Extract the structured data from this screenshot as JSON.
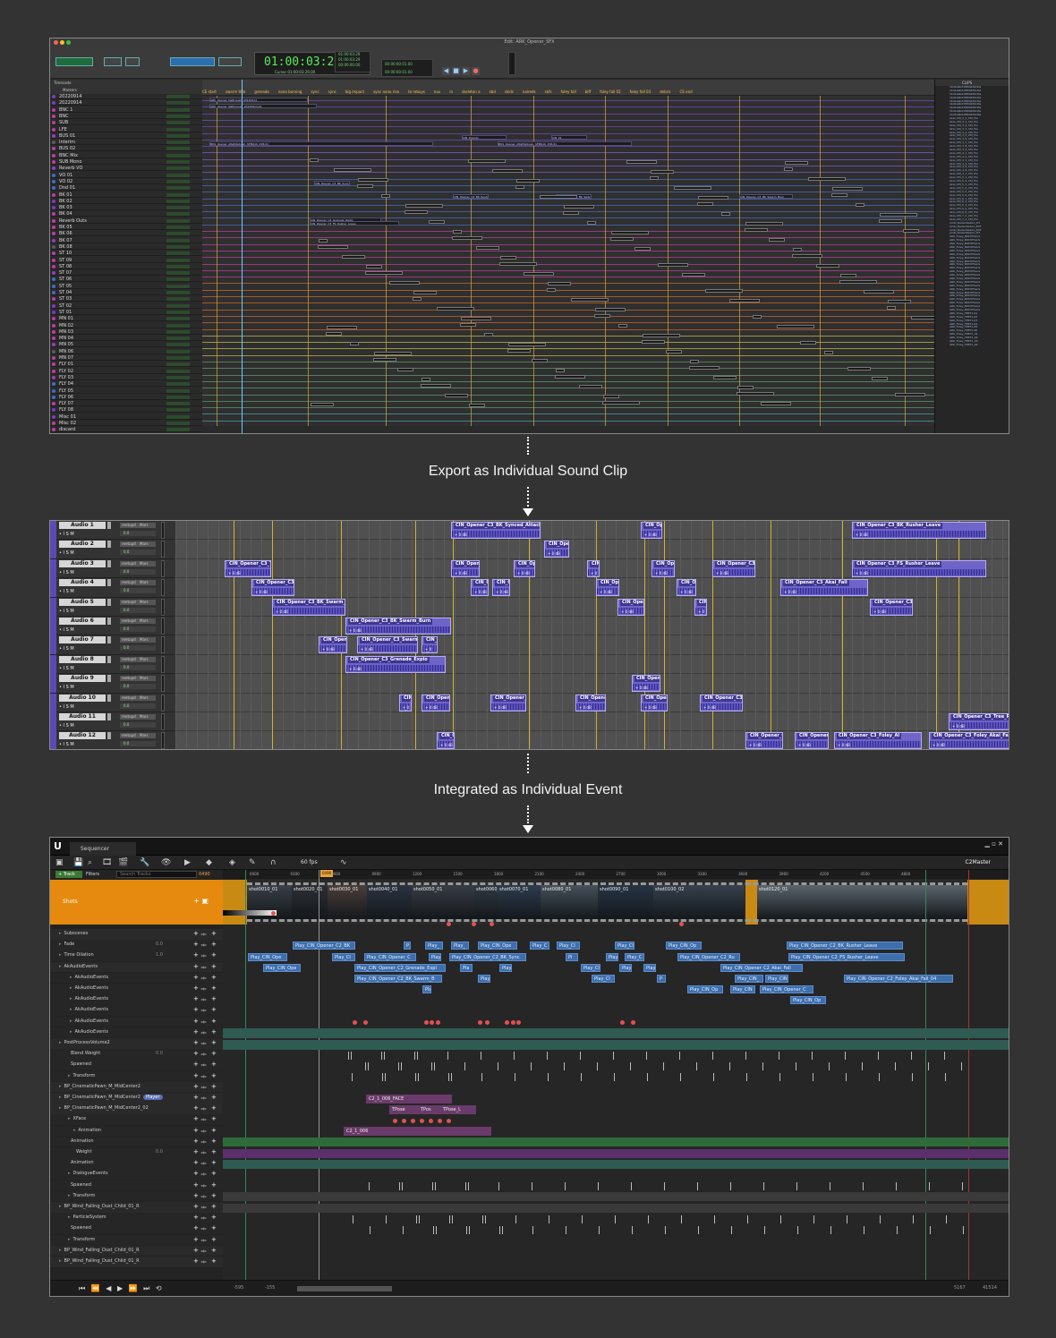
{
  "captions": {
    "export": "Export as Individual Sound Clip",
    "integrate": "Integrated as Individual Event"
  },
  "protools": {
    "window_title": "Edit: ARK_Opener_SFX",
    "main_counter": "01:00:03:29",
    "counter_sub": "Cursor  01:00:03:29.00",
    "selection_start": "01:00:03:29",
    "selection_end": "01:00:03:29",
    "selection_length": "00:00:00:00",
    "grid_value": "00:00:00:01.00",
    "nudge_value": "00:00:00:01.00",
    "timecode_label": "Timecode",
    "markers_label": "Markers",
    "markers": [
      "CE start",
      "swarm title",
      "grenade",
      "nano burning",
      "sync",
      "sync",
      "big impact",
      "sync nano rise",
      "to rebuys",
      "nuv",
      "in",
      "skeleton a",
      "sbd",
      "skids",
      "nalreds",
      "skfs",
      "foley fall",
      "biff",
      "foley fall 02",
      "foley fall 03",
      "debris",
      "CE end"
    ],
    "clips_header": "CLIPS",
    "tracks": [
      "20220914",
      "20220914",
      "BNC 1",
      "BNC",
      "SUB",
      "LFE",
      "BUS 01",
      "Interim",
      "BUS 02",
      "BNC Mix",
      "SUB Mono",
      "Reverb VO",
      "VO 01",
      "VO 02",
      "Dnd 01",
      "BK 01",
      "BK 02",
      "BK 03",
      "BK 04",
      "Reverb Outs",
      "BK 05",
      "BK 06",
      "BK 07",
      "BK 08",
      "ST 10",
      "ST 09",
      "ST 08",
      "ST 07",
      "ST 06",
      "ST 05",
      "ST 04",
      "ST 03",
      "ST 02",
      "ST 01",
      "MN 01",
      "MN 02",
      "MN 03",
      "MN 04",
      "MN 05",
      "MN 06",
      "MN 07",
      "FLY 01",
      "FLY 02",
      "FLY 03",
      "FLY 04",
      "FLY 05",
      "FLY 06",
      "FLY 07",
      "FLY 08",
      "Misc 01",
      "Misc 02",
      "discard"
    ],
    "clips": [
      "ARK_Opener_Deftrough_20220914",
      "ARK_Opener_Nathrough_20220914-01",
      "BUS_Opener_AltaMixdown_SFM010_158-01",
      "BUS_Opener_AltaMixdown_SFM010_158-01",
      "CIN_Opener",
      "CIN_01",
      "CIN_Opener_C3_BK_Synced_Attack",
      "CIN_Opener_C3_BK_Rusher_Lopes",
      "CIN_Opener_C3_BK_Swarm_Inflo",
      "CIN_Opener_C3_BK_Swarm_Burn",
      "CIN_Opener_C3_Grenade_Radio",
      "CIN_Opener_C3_FS_Rusher_Lopes",
      "ATMOS 2.1_01-01",
      "ATMOS 2.1_02"
    ],
    "cliplist": [
      "1bd1a9bd1f809b54dda",
      "1bd1a9bd1f809b54dda",
      "1bd1a9bd1f809b54dda",
      "1bd1a9bd1f809b54dda",
      "1bd1a9bd1f809b54dda",
      "1bd1a9bd1f809b54dda",
      "1bd1a9bd1f809b54dda",
      "1bd1a9bd1f809b54dda",
      "1bd1a9bd1f809b54dda",
      "Akai_CM_3_1_CM_Tra",
      "Akai_CM_3_1_CM_Tra",
      "Akai_CM_3_2_CM_Tra",
      "Akai_CM_3_3_CM_Tra",
      "Akai_CM_3_4_CM_Tra",
      "Akai_CM_3_5_CM_Tra",
      "Akai_CM_3_6_CM_Tra",
      "Akai_CM_3_7_CM_Tra",
      "Akai_CM_3_8_CM_Tra",
      "Akai_CM_3_9_CM_Tra",
      "Akai_CM_4_1_CM_Tra",
      "Akai_CM_4_2_CM_Tra",
      "Akai_CM_4_3_CM_Tra",
      "Akai_CM_4_4_CM_Tra",
      "Akai_CM_4_5_CM_Tra",
      "Akai_CM_4_6_CM_Tra",
      "Akai_CM_4_7_CM_Tra",
      "Akai_CM_5_1_CM_Tra",
      "Akai_CM_5_2_CM_Tra",
      "Akai_CM_5_3_CM_Tra",
      "Akai_CM_5_4_CM_Tra",
      "Akai_CM_5_5_CM_Tra",
      "Akai_CM_5_6_CM_Tra",
      "Akai_CM_6_1_CM_Tra",
      "Akai_CM_6_2_CM_Tra",
      "Akai_CM_6_3_CM_Tra",
      "Akai_CM_6_4_CM_Tra",
      "Akai_CM_6_5_CM_Tra",
      "Akai_CM_7_1_CM_Tra",
      "Akai_CM_7_2_CM_Tra",
      "ambi_RadarStation_DT",
      "ambi_RadarStation_EXT",
      "ambi_RadarStation_EXT",
      "ambi_RadarStation_DT",
      "ARK_Foley_BODYFALLS",
      "ARK_Foley_BODYFALLS",
      "ARK_Foley_BODYFALLS",
      "ARK_Foley_BODYFALLS",
      "ARK_Foley_BODYFALLS",
      "ARK_Foley_BODYFALLS",
      "ARK_Foley_BODYFALLS",
      "ARK_Foley_BODYFALLS",
      "ARK_Foley_BODYFALLS",
      "ARK_Foley_BODYFALLS",
      "ARK_Foley_BODYFALLS",
      "ARK_Foley_BODYFALLS",
      "ARK_Foley_BODYFALLS",
      "ARK_Foley_BODYFALLS",
      "ARK_Foley_BODYFALLS",
      "ARK_Foley_BODYFALLS",
      "ARK_Foley_BODYFALLS",
      "ARK_Foley_BODYFALLS",
      "ARK_Foley_BODYFALLS",
      "ARK_Foley_BODYFALLS",
      "ARK_Foley_BODYFALLS",
      "ARK_Foley_BODYFALLS",
      "ARK_Foley_FEET1-01",
      "ARK_Foley_FEET1-02",
      "ARK_Foley_FEET1-03",
      "ARK_Foley_FEET1-04",
      "ARK_Foley_FEET1-05",
      "ARK_Foley_FEET1-06",
      "ARK_Foley_FEET1_01",
      "ARK_Foley_FEET1_02",
      "ARK_Foley_FEET1_03",
      "ARK_Foley_FEET1_04"
    ]
  },
  "reaper": {
    "fx_label": "reetupd",
    "route_label": "Mars",
    "ctrl_label": "• I S M",
    "vol_value": "0.0",
    "tracks": [
      "Audio 1",
      "Audio 2",
      "Audio 3",
      "Audio 4",
      "Audio 5",
      "Audio 6",
      "Audio 7",
      "Audio 8",
      "Audio 9",
      "Audio 10",
      "Audio 11",
      "Audio 12"
    ],
    "item_db": "+ 0 dB",
    "items": [
      "CIN_Opener_C3_BK_Synced_Attack",
      "CIN_Opn",
      "CIN_Opener_C3_BK_Rusher_Leave",
      "CIN_Open",
      "CIN_Opener_C3_Tra",
      "CIN_Opene",
      "CIN_Ops",
      "CIN_",
      "CIN_Opni",
      "CIN_Opener_C3_R",
      "CIN_Opener_C3_FS_Rusher_Leave",
      "CIN_Opener_C3_G",
      "CIN_Op",
      "CIN_Op",
      "CIN_Opr",
      "CIN_Op",
      "CIN_Opener_C3_Akai_Fall",
      "CIN_Opener_C3_BK_Swarm_Idle",
      "CIN_Opene",
      "CIN_",
      "CIN_Opener_C3_B",
      "CIN_Opener_C3_BK_Swarm_Burn",
      "CIN_Opene",
      "CIN_Opener_C3_Swarm_Bu",
      "CIN_I",
      "CIN_Opener_C3_Grenade_Explo",
      "CIN_Opener",
      "CIN",
      "CIN_Opene",
      "CIN_Opener_C",
      "CIN_Opener",
      "CIN_Opene",
      "CIN_Opener_C3_A",
      "CIN_Opener_C3_Tree_Rustle_Dub",
      "CIN_Op",
      "CIN_Opener_C3_",
      "CIN_Opener_C",
      "CIN_Opener_C3_Foley_Al",
      "CIN_Opener_C3_Foley_Akai_Fall_04"
    ]
  },
  "unreal": {
    "logo": "U",
    "tab": "Sequencer",
    "fps": "60 fps",
    "sequence_name": "C2Master",
    "track_button": "+ Track",
    "filters": "Filters",
    "search_placeholder": "Search Tracks",
    "current_frame": "0490",
    "ruler_current": "0490",
    "ruler": [
      "0000",
      "0300",
      "0600",
      "0900",
      "1200",
      "1500",
      "1800",
      "2100",
      "2400",
      "2700",
      "3000",
      "3300",
      "3600",
      "3900",
      "4200",
      "4500",
      "4800"
    ],
    "shots_label": "Shots",
    "shots": [
      "shot0010_01",
      "shot0020_01",
      "shot0030_01",
      "shot0040_01",
      "shot0050_01",
      "shot0060_01",
      "shot0070_01",
      "shot0080_01",
      "shot0090_01",
      "shot0100_02",
      "shot0120_01"
    ],
    "rows": [
      {
        "label": "Subscenes",
        "val": "",
        "indent": 10
      },
      {
        "label": "Fade",
        "val": "0.0",
        "indent": 10
      },
      {
        "label": "Time Dilation",
        "val": "1.0",
        "indent": 10
      },
      {
        "label": "AkAudioEvents",
        "val": "",
        "indent": 10
      },
      {
        "label": "AkAudioEvents",
        "val": "",
        "indent": 22
      },
      {
        "label": "AkAudioEvents",
        "val": "",
        "indent": 22
      },
      {
        "label": "AkAudioEvents",
        "val": "",
        "indent": 22
      },
      {
        "label": "AkAudioEvents",
        "val": "",
        "indent": 22
      },
      {
        "label": "AkAudioEvents",
        "val": "",
        "indent": 22
      },
      {
        "label": "AkAudioEvents",
        "val": "",
        "indent": 22
      },
      {
        "label": "PostProcessVolume2",
        "val": "",
        "indent": 10
      },
      {
        "label": "Blend Weight",
        "val": "0.0",
        "indent": 20
      },
      {
        "label": "Spawned",
        "val": "",
        "indent": 20
      },
      {
        "label": "Transform",
        "val": "",
        "indent": 20
      },
      {
        "label": "BP_CinematicPawn_M_MidCenter2",
        "val": "",
        "indent": 10
      },
      {
        "label": "BP_CinematicPawn_M_MidCenter2",
        "val": "",
        "indent": 10
      },
      {
        "label": "BP_CinematicPawn_M_MidCenter2_02",
        "val": "",
        "indent": 10
      },
      {
        "label": "XFace",
        "val": "",
        "indent": 20
      },
      {
        "label": "Animation",
        "val": "",
        "indent": 26
      },
      {
        "label": "Animation",
        "val": "",
        "indent": 20
      },
      {
        "label": "Weight",
        "val": "0.0",
        "indent": 26
      },
      {
        "label": "Animation",
        "val": "",
        "indent": 20
      },
      {
        "label": "DialogueEvents",
        "val": "",
        "indent": 20
      },
      {
        "label": "Spawned",
        "val": "",
        "indent": 20
      },
      {
        "label": "Transform",
        "val": "",
        "indent": 20
      },
      {
        "label": "BP_Wind_Falling_Dust_Child_01_R",
        "val": "",
        "indent": 10
      },
      {
        "label": "ParticleSystem",
        "val": "",
        "indent": 20
      },
      {
        "label": "Spawned",
        "val": "",
        "indent": 20
      },
      {
        "label": "Transform",
        "val": "",
        "indent": 20
      },
      {
        "label": "BP_Wind_Falling_Dust_Child_01_R",
        "val": "",
        "indent": 10
      },
      {
        "label": "BP_Wind_Falling_Dust_Child_01_R",
        "val": "",
        "indent": 10
      }
    ],
    "player_badge": "Player",
    "events": [
      "Play_CIN_Opener_C2_BK",
      "P",
      "Play_",
      "Play_",
      "Play_CIN_Ope",
      "Play_C",
      "Play_Cl",
      "Play_Cl",
      "Play_CIN_Op",
      "Play_CIN_Opener_C2_BK_Rusher_Leave",
      "Play_CIN_Ope",
      "Play_Cl",
      "Play_CIN_Opener_C",
      "Play",
      "Play_CIN_Opener_C2_BK_Sync",
      "Pl",
      "Play",
      "Play_C",
      "Play_CIN_Opener_C2_Ru",
      "Play_CIN_Opener_C2_FS_Rusher_Leave",
      "Play_CIN_Ope",
      "Play_CIN_Opener_C2_Grenade_Expl",
      "Pla",
      "Play",
      "Play_Cl",
      "Play_",
      "Play_",
      "Play_CIN_Opener_C2_Akai_Fall",
      "Play_CIN_Opener_C2_BK_Swarm_B",
      "Play",
      "Play_Cl",
      "P",
      "Play_CIN_",
      "Play_CIN_",
      "Play_CIN_Opener_C2_Foley_Akai_Fall_04",
      "Pla",
      "Play_CIN_Op",
      "Play_CIN",
      "Play_CIN_Opener_C",
      "Play_CIN_Op"
    ],
    "sections": [
      "C2_1_006_FACE",
      "TPose",
      "TPos",
      "TPose_L",
      "C2_1_006"
    ],
    "range_start": "-595",
    "range_start2": "-155",
    "range_end": "5167",
    "range_end2": "41514"
  }
}
